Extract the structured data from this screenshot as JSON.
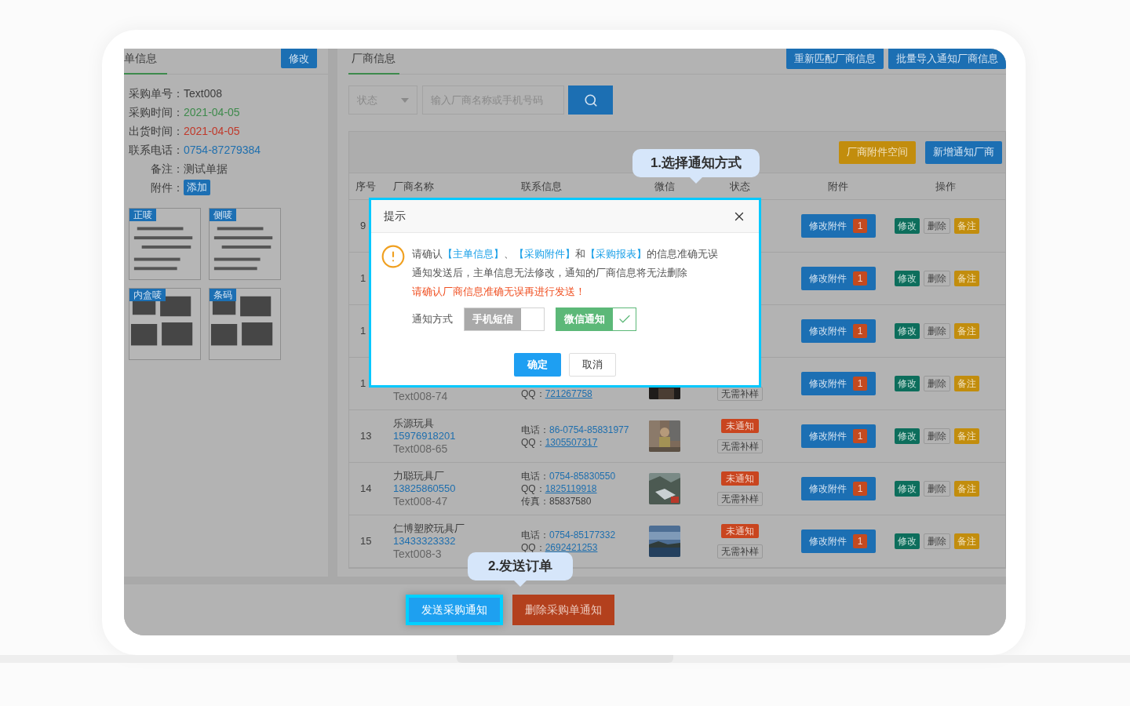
{
  "main_info": {
    "title": "单信息",
    "edit_button": "修改",
    "fields": [
      {
        "label": "采购单号：",
        "value": "Text008",
        "color": "#3d3d3d"
      },
      {
        "label": "采购时间：",
        "value": "2021-04-05",
        "color": "#3e8a4c"
      },
      {
        "label": "出货时间：",
        "value": "2021-04-05",
        "color": "#c0392b"
      },
      {
        "label": "联系电话：",
        "value": "0754-87279384",
        "color": "#1f6fae"
      },
      {
        "label": "备注：",
        "value": "测试单据",
        "color": "#3d3d3d"
      }
    ],
    "attachment_label": "附件：",
    "add_button": "添加",
    "thumbnails": [
      {
        "tag": "正唛",
        "kind": "picture"
      },
      {
        "tag": "侧唛",
        "kind": "picture"
      },
      {
        "tag": "内盒唛",
        "kind": "picture"
      },
      {
        "tag": "条码",
        "kind": "picture"
      }
    ]
  },
  "vendor": {
    "title": "厂商信息",
    "actions": [
      "重新匹配厂商信息",
      "批量导入通知厂商信息"
    ],
    "status_select": "状态",
    "search_placeholder": "输入厂商名称或手机号码",
    "toolbar": [
      {
        "label": "厂商附件空间",
        "kind": "warning"
      },
      {
        "label": "新增通知厂商",
        "kind": "primary"
      }
    ],
    "table": {
      "columns": [
        "序号",
        "厂商名称",
        "联系信息",
        "微信",
        "状态",
        "附件",
        "操作"
      ],
      "rows": [
        {
          "seq": "9",
          "attach_button": "修改附件",
          "attach_count": "1",
          "ops": [
            "修改",
            "删除",
            "备注"
          ]
        },
        {
          "seq": "1",
          "attach_button": "修改附件",
          "attach_count": "1",
          "ops": [
            "修改",
            "删除",
            "备注"
          ]
        },
        {
          "seq": "1",
          "attach_button": "修改附件",
          "attach_count": "1",
          "ops": [
            "修改",
            "删除",
            "备注"
          ]
        },
        {
          "seq": "1",
          "code": "Text008-74",
          "contacts": [
            {
              "label": "QQ：",
              "value": "721267758",
              "kind": "link"
            }
          ],
          "wechat": {
            "kind": "picture"
          },
          "sample": "无需补样",
          "attach_button": "修改附件",
          "attach_count": "1",
          "ops": [
            "修改",
            "删除",
            "备注"
          ]
        },
        {
          "seq": "13",
          "name": "乐源玩具",
          "phone": "15976918201",
          "code": "Text008-65",
          "contacts": [
            {
              "label": "电话：",
              "value": "86-0754-85831977",
              "kind": "accent"
            },
            {
              "label": "QQ：",
              "value": "1305507317",
              "kind": "link"
            }
          ],
          "wechat": {
            "kind": "picture"
          },
          "status": "未通知",
          "sample": "无需补样",
          "attach_button": "修改附件",
          "attach_count": "1",
          "ops": [
            "修改",
            "删除",
            "备注"
          ]
        },
        {
          "seq": "14",
          "name": "力聪玩具厂",
          "phone": "13825860550",
          "code": "Text008-47",
          "contacts": [
            {
              "label": "电话：",
              "value": "0754-85830550",
              "kind": "accent"
            },
            {
              "label": "QQ：",
              "value": "1825119918",
              "kind": "link"
            },
            {
              "label": "传真：",
              "value": "85837580",
              "kind": "plain"
            }
          ],
          "wechat": {
            "kind": "picture"
          },
          "status": "未通知",
          "sample": "无需补样",
          "attach_button": "修改附件",
          "attach_count": "1",
          "ops": [
            "修改",
            "删除",
            "备注"
          ]
        },
        {
          "seq": "15",
          "name": "仁博塑胶玩具厂",
          "phone": "13433323332",
          "code": "Text008-3",
          "contacts": [
            {
              "label": "电话：",
              "value": "0754-85177332",
              "kind": "accent"
            },
            {
              "label": "QQ：",
              "value": "2692421253",
              "kind": "link"
            }
          ],
          "wechat": {
            "kind": "picture"
          },
          "status": "未通知",
          "sample": "无需补样",
          "attach_button": "修改附件",
          "attach_count": "1",
          "ops": [
            "修改",
            "删除",
            "备注"
          ]
        }
      ]
    }
  },
  "dialog": {
    "title": "提示",
    "message_parts": [
      {
        "text": "请确认",
        "highlight": false
      },
      {
        "text": "【主单信息】",
        "highlight": true
      },
      {
        "text": "、",
        "highlight": false
      },
      {
        "text": "【采购附件】",
        "highlight": true
      },
      {
        "text": "和",
        "highlight": false
      },
      {
        "text": "【采购报表】",
        "highlight": true
      },
      {
        "text": "的信息准确无误",
        "highlight": false
      }
    ],
    "note": "通知发送后，主单信息无法修改，通知的厂商信息将无法删除",
    "warning": "请确认厂商信息准确无误再进行发送！",
    "method_label": "通知方式",
    "methods": [
      {
        "label": "手机短信",
        "selected": false
      },
      {
        "label": "微信通知",
        "selected": true
      }
    ],
    "buttons": [
      {
        "label": "确定",
        "kind": "primary"
      },
      {
        "label": "取消",
        "kind": "default"
      }
    ]
  },
  "callouts": [
    "1.选择通知方式",
    "2.发送订单"
  ],
  "footer_buttons": [
    {
      "label": "发送采购通知",
      "kind": "primary",
      "highlighted": true
    },
    {
      "label": "删除采购单通知",
      "kind": "danger",
      "highlighted": false
    }
  ]
}
